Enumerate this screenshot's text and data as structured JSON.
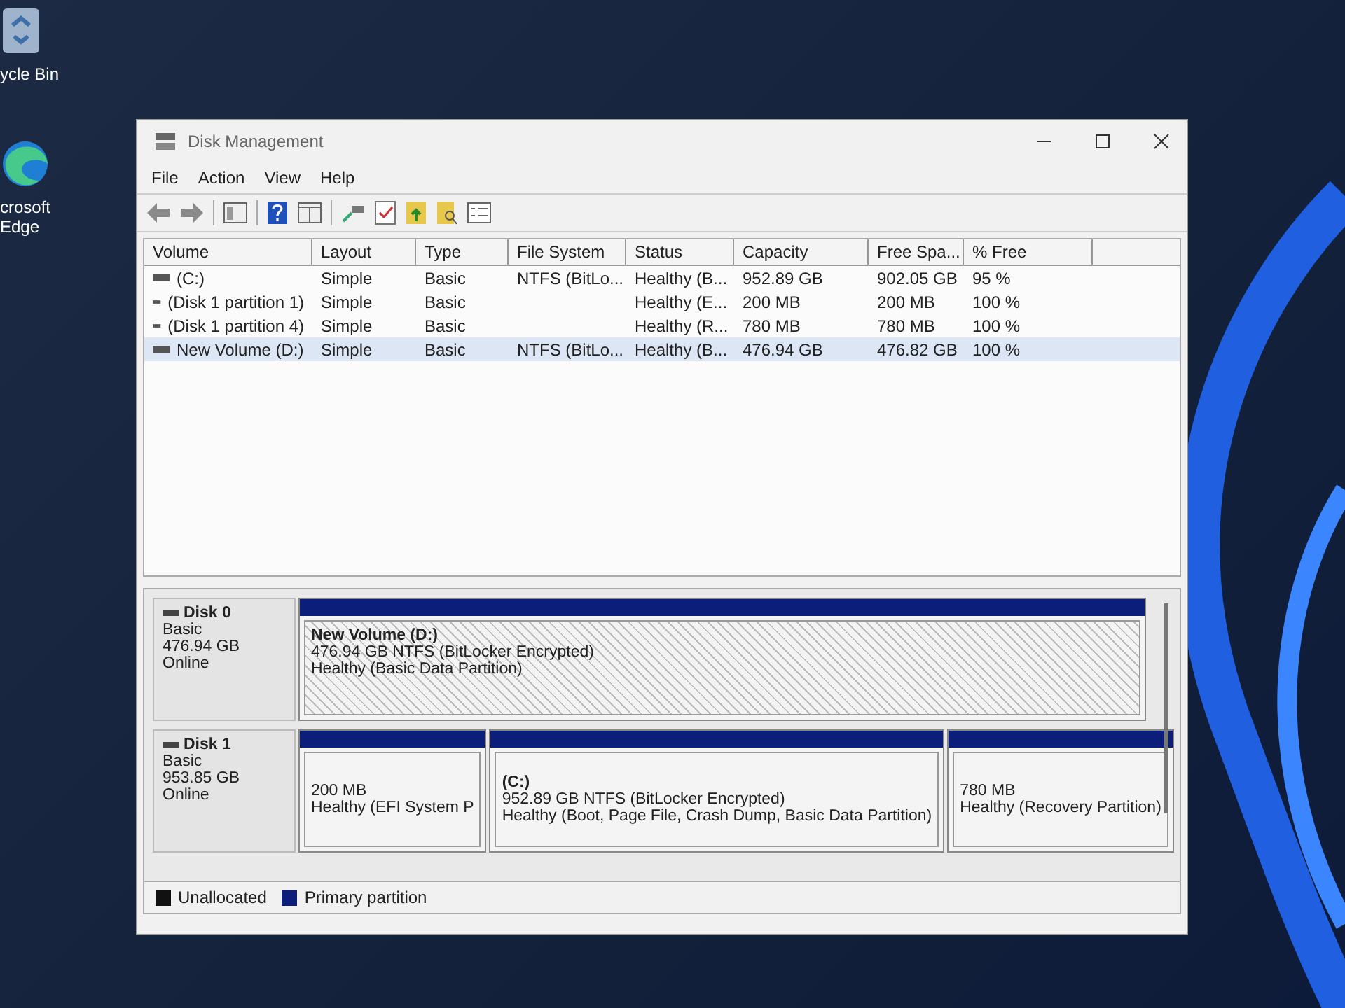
{
  "desktop_icons": [
    {
      "kind": "bin",
      "lines": [
        "ycle Bin"
      ]
    },
    {
      "kind": "browser",
      "lines": [
        "crosoft",
        "Edge"
      ]
    }
  ],
  "window": {
    "title": "Disk Management"
  },
  "menu": [
    "File",
    "Action",
    "View",
    "Help"
  ],
  "table": {
    "columns": [
      "Volume",
      "Layout",
      "Type",
      "File System",
      "Status",
      "Capacity",
      "Free Spa...",
      "% Free"
    ],
    "rows": [
      {
        "selected": false,
        "cells": [
          "(C:)",
          "Simple",
          "Basic",
          "NTFS (BitLo...",
          "Healthy (B...",
          "952.89 GB",
          "902.05 GB",
          "95 %"
        ]
      },
      {
        "selected": false,
        "cells": [
          "(Disk 1 partition 1)",
          "Simple",
          "Basic",
          "",
          "Healthy (E...",
          "200 MB",
          "200 MB",
          "100 %"
        ]
      },
      {
        "selected": false,
        "cells": [
          "(Disk 1 partition 4)",
          "Simple",
          "Basic",
          "",
          "Healthy (R...",
          "780 MB",
          "780 MB",
          "100 %"
        ]
      },
      {
        "selected": true,
        "cells": [
          "New Volume (D:)",
          "Simple",
          "Basic",
          "NTFS (BitLo...",
          "Healthy (B...",
          "476.94 GB",
          "476.82 GB",
          "100 %"
        ]
      }
    ]
  },
  "disks": [
    {
      "name": "Disk 0",
      "info": [
        "Basic",
        "476.94 GB",
        "Online"
      ],
      "partitions": [
        {
          "selected": true,
          "title": "New Volume  (D:)",
          "lines": [
            "476.94 GB NTFS (BitLocker Encrypted)",
            "Healthy (Basic Data Partition)"
          ]
        }
      ]
    },
    {
      "name": "Disk 1",
      "info": [
        "Basic",
        "953.85 GB",
        "Online"
      ],
      "partitions": [
        {
          "selected": false,
          "lines": [
            "200 MB",
            "Healthy (EFI System P"
          ]
        },
        {
          "selected": false,
          "title": "(C:)",
          "lines": [
            "952.89 GB NTFS (BitLocker Encrypted)",
            "Healthy (Boot, Page File, Crash Dump, Basic Data Partition)"
          ]
        },
        {
          "selected": false,
          "lines": [
            "780 MB",
            "Healthy (Recovery Partition)"
          ]
        }
      ]
    }
  ],
  "legend": [
    {
      "label": "Unallocated",
      "color": "#111111"
    },
    {
      "label": "Primary partition",
      "color": "#0b1f7a"
    }
  ]
}
